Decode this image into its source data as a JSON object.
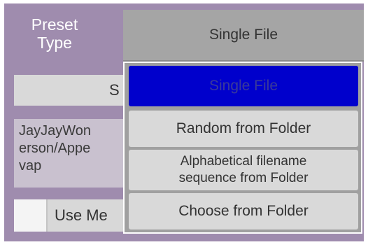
{
  "preset_type": {
    "label_line1": "Preset",
    "label_line2": "Type",
    "selected_value": "Single File"
  },
  "partial_button": {
    "label": "S"
  },
  "path_text": {
    "line1": "JayJayWon",
    "line2": "erson/Appe",
    "line3": "vap"
  },
  "toggle": {
    "label": "Use Me",
    "checked": false
  },
  "dropdown": {
    "options": [
      {
        "label": "Single File",
        "selected": true
      },
      {
        "label": "Random from Folder",
        "selected": false
      },
      {
        "label_line1": "Alphabetical filename",
        "label_line2": "sequence from Folder",
        "selected": false
      },
      {
        "label": "Choose from Folder",
        "selected": false
      }
    ]
  },
  "colors": {
    "panel_bg": "#9f8cae",
    "selected_option_bg": "#0000cc",
    "option_bg": "#d9d9d9"
  }
}
